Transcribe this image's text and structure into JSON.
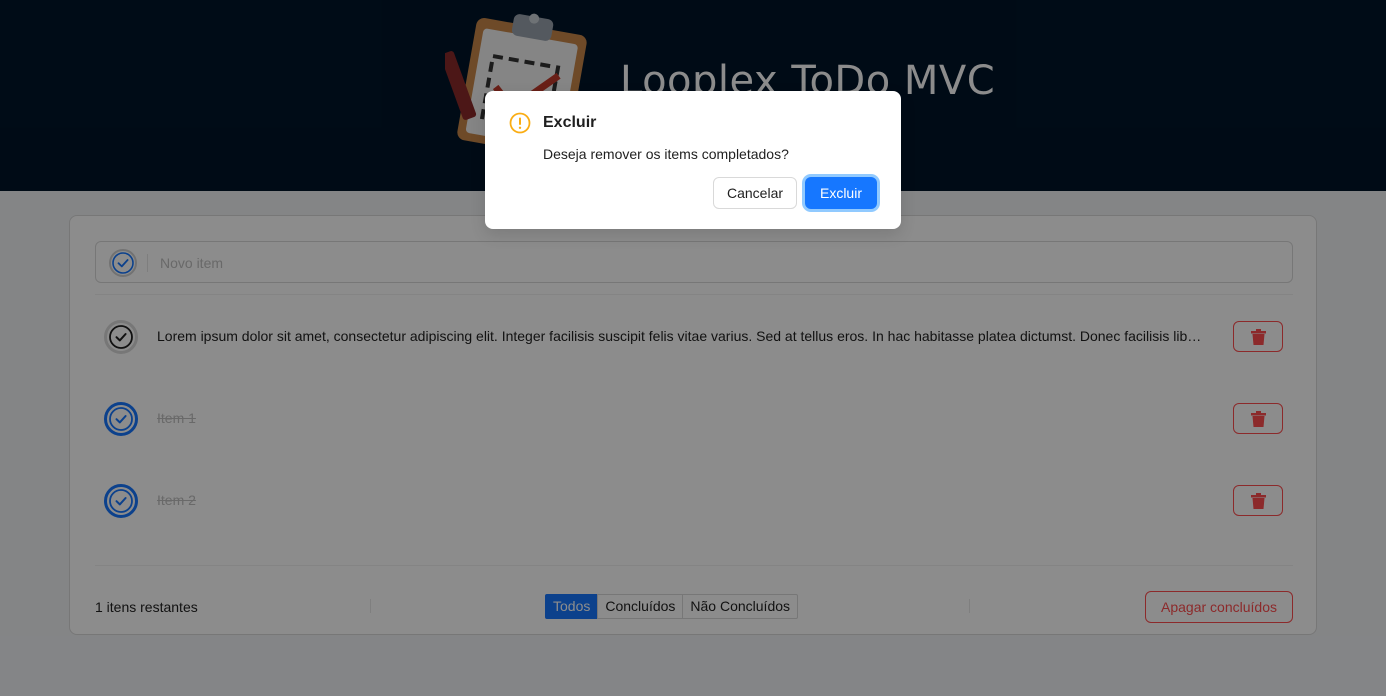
{
  "header": {
    "title": "Looplex ToDo MVC",
    "logo_icon": "clipboard-checklist-logo",
    "background": "#001529"
  },
  "new_item": {
    "placeholder": "Novo item",
    "toggle_icon": "check-circle-icon"
  },
  "todos": [
    {
      "text": "Lorem ipsum dolor sit amet, consectetur adipiscing elit. Integer facilisis suscipit felis vitae varius. Sed at tellus eros. In hac habitasse platea dictumst. Donec facilisis libero ...",
      "completed": false
    },
    {
      "text": "Item 1",
      "completed": true
    },
    {
      "text": "Item 2",
      "completed": true
    }
  ],
  "delete_icon": "trash-icon",
  "footer": {
    "count_text": "1 itens restantes",
    "filters": [
      "Todos",
      "Concluídos",
      "Não Concluídos"
    ],
    "active_filter": "Todos",
    "clear_label": "Apagar concluídos"
  },
  "modal": {
    "icon": "exclamation-circle-icon",
    "title": "Excluir",
    "content": "Deseja remover os items completados?",
    "cancel_label": "Cancelar",
    "ok_label": "Excluir"
  },
  "colors": {
    "primary": "#1677ff",
    "danger": "#ff4d4f",
    "warning": "#faad14"
  }
}
